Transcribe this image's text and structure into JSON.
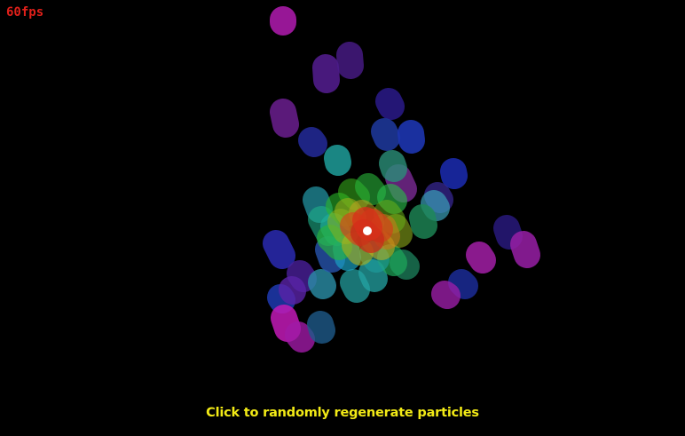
{
  "status": {
    "fps_label": "60fps"
  },
  "hint": {
    "text": "Click to randomly regenerate particles"
  },
  "colors": {
    "background": "#000000",
    "fps_text": "#e0201a",
    "hint_text": "#f2ea16",
    "center_dot": "#ffffff"
  }
}
